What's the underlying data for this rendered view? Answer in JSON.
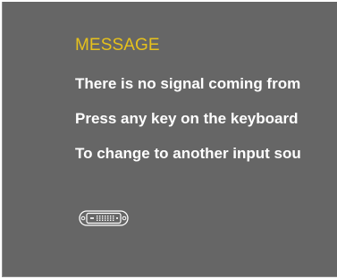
{
  "dialog": {
    "title": "MESSAGE",
    "lines": [
      "There is no signal coming from",
      "Press any key on the keyboard",
      "To change to another input sou"
    ]
  },
  "icons": {
    "connector": "dvi-connector-icon"
  },
  "colors": {
    "background": "#666666",
    "title": "#e6c11c",
    "text": "#ffffff"
  }
}
